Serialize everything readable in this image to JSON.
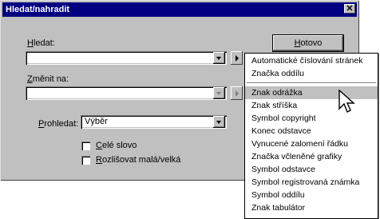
{
  "dialog": {
    "title": "Hledat/nahradit",
    "find_label": "Hledat:",
    "find_mnemonic": "H",
    "find_rest": "ledat:",
    "find_value": "",
    "replace_label": "Změnit na:",
    "replace_mnemonic": "Z",
    "replace_rest": "měnit na:",
    "replace_value": "",
    "search_label": "Prohledat:",
    "search_mnemonic": "P",
    "search_rest": "rohledat:",
    "search_value": "Výběr",
    "whole_word": {
      "mnemonic": "C",
      "rest": "elé slovo",
      "checked": false
    },
    "match_case": {
      "mnemonic": "R",
      "rest": "ozlišovat malá/velká",
      "checked": false
    },
    "done_button": {
      "mnemonic": "H",
      "rest": "otovo"
    }
  },
  "menu": {
    "group1": [
      "Automatické číslování stránek",
      "Značka oddílu"
    ],
    "group2": [
      "Znak odrážka",
      "Znak stříška",
      "Symbol copyright",
      "Konec odstavce",
      "Vynucené zalomení řádku",
      "Značka včleněné grafiky",
      "Symbol odstavce",
      "Symbol registrovaná známka",
      "Symbol oddílu",
      "Znak tabulátor"
    ],
    "highlighted": "Znak odrážka"
  },
  "icons": {
    "close": "close-icon",
    "cursor": "mouse-cursor-icon"
  }
}
